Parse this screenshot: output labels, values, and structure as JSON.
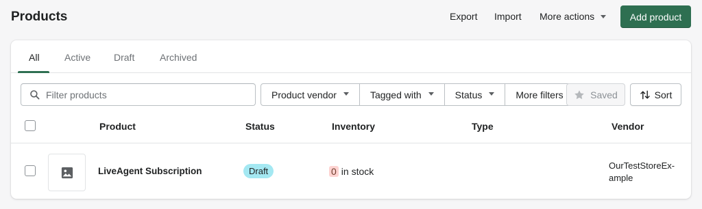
{
  "header": {
    "title": "Products",
    "export_label": "Export",
    "import_label": "Import",
    "more_actions_label": "More actions",
    "add_product_label": "Add product"
  },
  "tabs": [
    {
      "label": "All",
      "active": true
    },
    {
      "label": "Active",
      "active": false
    },
    {
      "label": "Draft",
      "active": false
    },
    {
      "label": "Archived",
      "active": false
    }
  ],
  "filters": {
    "search_placeholder": "Filter products",
    "search_value": "",
    "product_vendor_label": "Product vendor",
    "tagged_with_label": "Tagged with",
    "status_label": "Status",
    "more_filters_label": "More filters",
    "saved_label": "Saved",
    "sort_label": "Sort"
  },
  "table": {
    "columns": [
      "Product",
      "Status",
      "Inventory",
      "Type",
      "Vendor"
    ],
    "rows": [
      {
        "product": "LiveAgent Subscription",
        "status": "Draft",
        "inventory_count": "0",
        "inventory_suffix": "in stock",
        "type": "",
        "vendor": "OurTestStoreEx-ample"
      }
    ]
  },
  "colors": {
    "primary_button": "#2e6f51",
    "draft_badge_bg": "#a4e8f2",
    "inventory_zero_bg": "#fed3d1",
    "tab_underline": "#2e6f51"
  },
  "icons": {
    "search": "search-icon",
    "star": "star-icon",
    "sort": "sort-arrows-icon",
    "image_placeholder": "image-icon",
    "chevron": "chevron-down-icon"
  }
}
